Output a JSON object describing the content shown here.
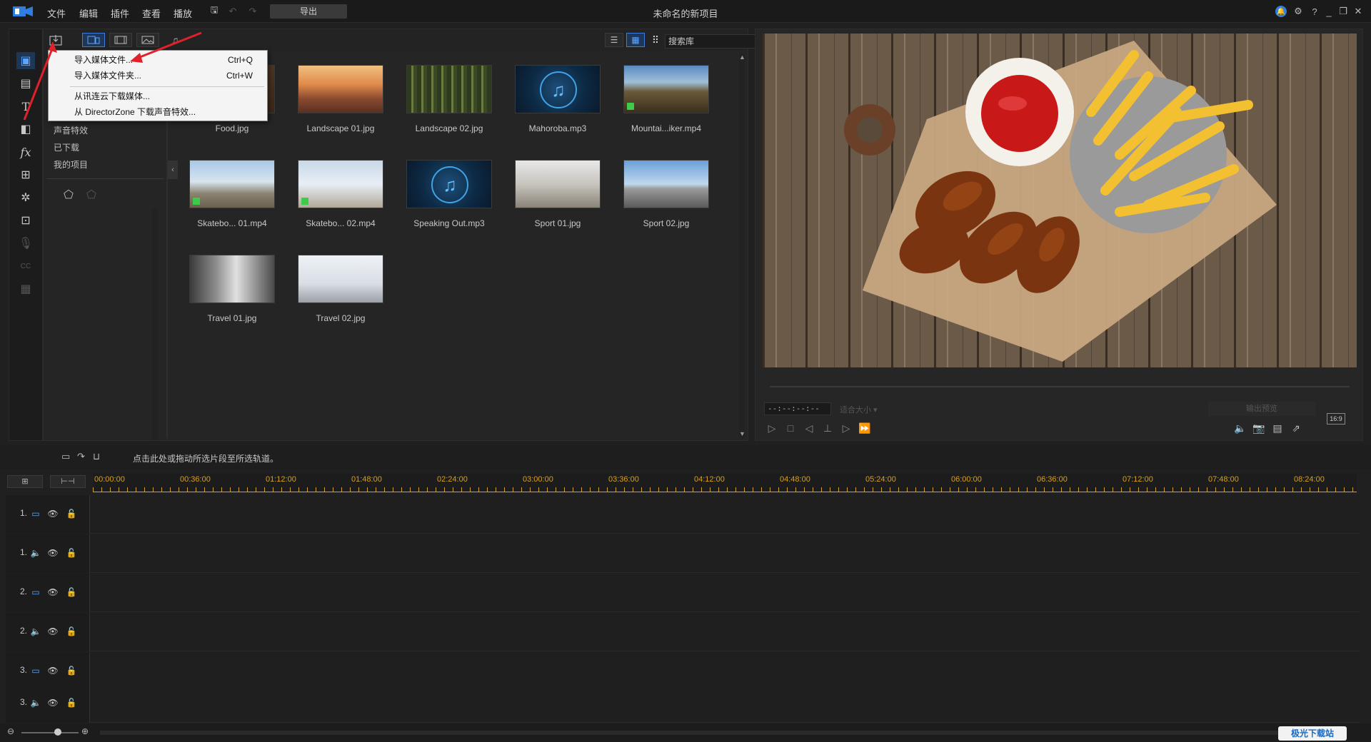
{
  "titlebar": {
    "menus": [
      "文件",
      "编辑",
      "插件",
      "查看",
      "播放"
    ],
    "export_label": "导出",
    "title": "未命名的新项目"
  },
  "library": {
    "search_placeholder": "搜索库",
    "categories": [
      "声音特效",
      "已下载",
      "我的项目"
    ],
    "items": [
      {
        "label": "Food.jpg",
        "kind": "image"
      },
      {
        "label": "Landscape 01.jpg",
        "kind": "image"
      },
      {
        "label": "Landscape 02.jpg",
        "kind": "image"
      },
      {
        "label": "Mahoroba.mp3",
        "kind": "audio"
      },
      {
        "label": "Mountai...iker.mp4",
        "kind": "video"
      },
      {
        "label": "Skatebo... 01.mp4",
        "kind": "video"
      },
      {
        "label": "Skatebo... 02.mp4",
        "kind": "video"
      },
      {
        "label": "Speaking Out.mp3",
        "kind": "audio"
      },
      {
        "label": "Sport 01.jpg",
        "kind": "image"
      },
      {
        "label": "Sport 02.jpg",
        "kind": "image"
      },
      {
        "label": "Travel 01.jpg",
        "kind": "image"
      },
      {
        "label": "Travel 02.jpg",
        "kind": "image"
      }
    ]
  },
  "import_menu": {
    "items": [
      {
        "label": "导入媒体文件...",
        "shortcut": "Ctrl+Q"
      },
      {
        "label": "导入媒体文件夹...",
        "shortcut": "Ctrl+W"
      },
      {
        "label": "从讯连云下载媒体...",
        "shortcut": ""
      },
      {
        "label": "从 DirectorZone 下载声音特效...",
        "shortcut": ""
      }
    ]
  },
  "preview": {
    "timecode": "--:--:--:--",
    "fit_label": "适合大小",
    "output_label": "输出预览",
    "aspect": "16:9"
  },
  "timeline": {
    "hint": "点击此处或拖动所选片段至所选轨道。",
    "ruler": [
      "00:00:00",
      "00:36:00",
      "01:12:00",
      "01:48:00",
      "02:24:00",
      "03:00:00",
      "03:36:00",
      "04:12:00",
      "04:48:00",
      "05:24:00",
      "06:00:00",
      "06:36:00",
      "07:12:00",
      "07:48:00",
      "08:24:00"
    ],
    "tracks": [
      {
        "label": "1.",
        "type": "video"
      },
      {
        "label": "1.",
        "type": "audio"
      },
      {
        "label": "2.",
        "type": "video"
      },
      {
        "label": "2.",
        "type": "audio"
      },
      {
        "label": "3.",
        "type": "video"
      },
      {
        "label": "3.",
        "type": "audio"
      }
    ]
  },
  "watermark": {
    "text": "极光下载站"
  },
  "colors": {
    "accent": "#3f7ce0",
    "ruler": "#d8a020",
    "annotation": "#e0202a"
  }
}
